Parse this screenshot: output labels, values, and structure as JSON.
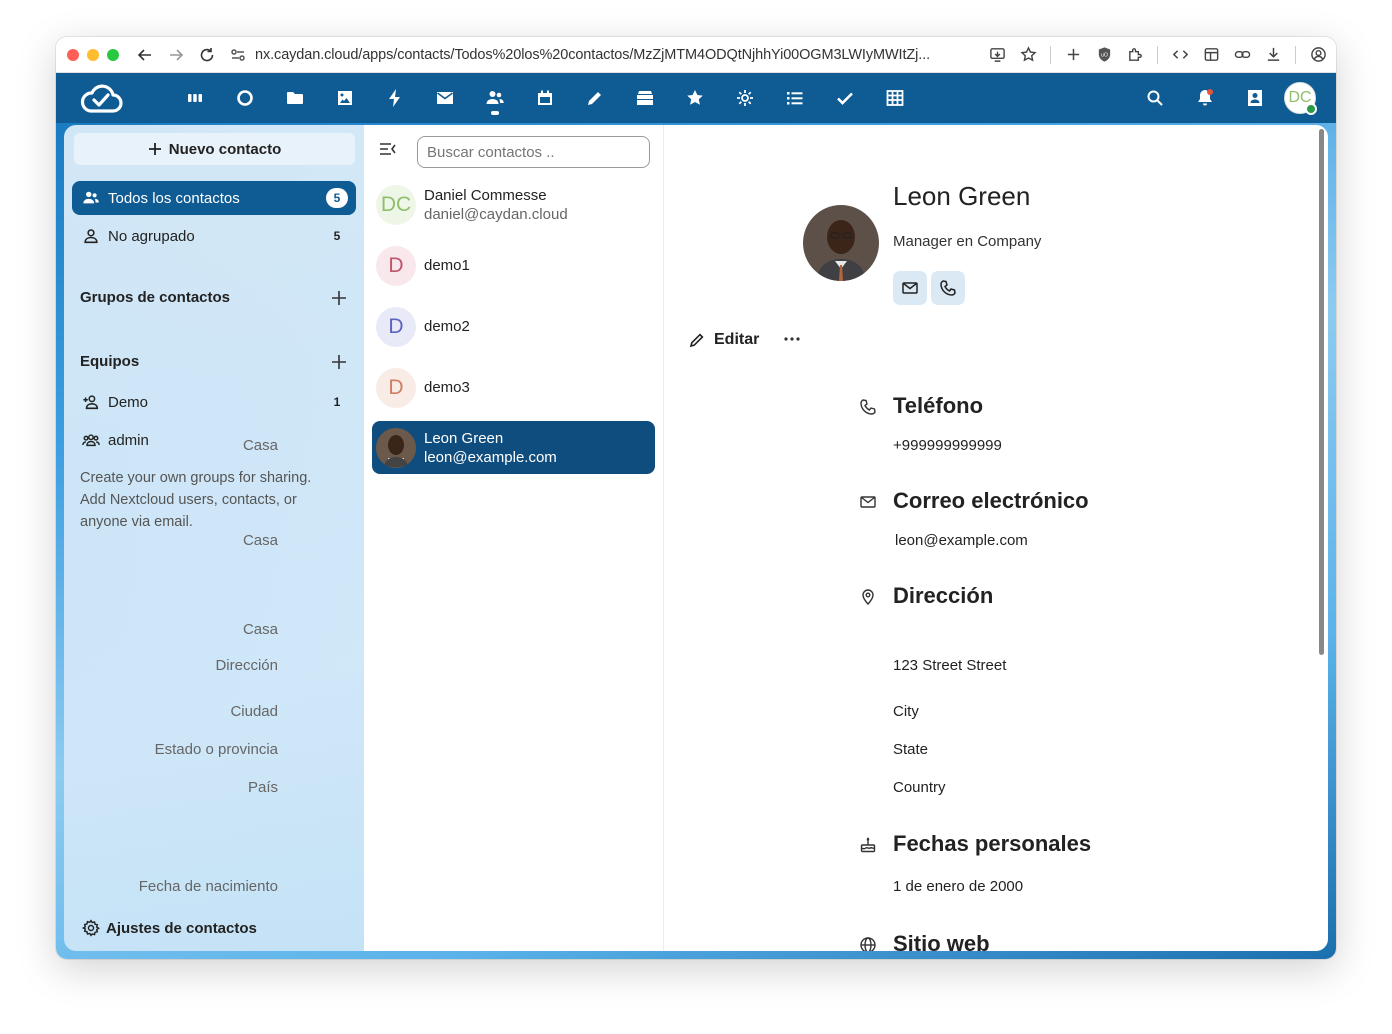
{
  "browser": {
    "url": "nx.caydan.cloud/apps/contacts/Todos%20los%20contactos/MzZjMTM4ODQtNjhhYi00OGM3LWIyMWItZj..."
  },
  "header": {
    "user_initials": "DC",
    "apps": [
      "dashboard",
      "search",
      "files",
      "photos",
      "activity",
      "mail",
      "contacts",
      "calendar",
      "notes",
      "deck",
      "favorites",
      "circles",
      "tasks-list",
      "tasks",
      "tables"
    ]
  },
  "sidebar": {
    "new_contact": "Nuevo contacto",
    "items": [
      {
        "label": "Todos los contactos",
        "count": "5"
      },
      {
        "label": "No agrupado",
        "count": "5"
      }
    ],
    "groups_title": "Grupos de contactos",
    "teams_title": "Equipos",
    "teams": [
      {
        "label": "Demo",
        "count": "1"
      },
      {
        "label": "admin",
        "count": ""
      }
    ],
    "help_text": "Create your own groups for sharing. Add Nextcloud users, contacts, or anyone via email.",
    "settings": "Ajustes de contactos"
  },
  "list": {
    "search_placeholder": "Buscar contactos ..",
    "contacts": [
      {
        "initials": "DC",
        "name": "Daniel Commesse",
        "email": "daniel@caydan.cloud",
        "color": "#8fbf6c",
        "bg": "#eef6e8"
      },
      {
        "initials": "D",
        "name": "demo1",
        "email": "",
        "color": "#c0546a",
        "bg": "#f8e8ec"
      },
      {
        "initials": "D",
        "name": "demo2",
        "email": "",
        "color": "#5b64c0",
        "bg": "#e8eaf7"
      },
      {
        "initials": "D",
        "name": "demo3",
        "email": "",
        "color": "#d17d66",
        "bg": "#f9ebe6"
      },
      {
        "initials": "",
        "name": "Leon Green",
        "email": "leon@example.com",
        "color": "#fff",
        "bg": "#333"
      }
    ]
  },
  "details": {
    "name": "Leon Green",
    "title": "Manager en Company",
    "edit": "Editar",
    "phone_title": "Teléfono",
    "phone_label": "Casa",
    "phone_value": "+999999999999",
    "email_title": "Correo electrónico",
    "email_label": "Casa",
    "email_value": "leon@example.com",
    "address_title": "Dirección",
    "address_type": "Casa",
    "address_fields": [
      {
        "label": "Dirección",
        "value": "123 Street Street"
      },
      {
        "label": "Ciudad",
        "value": "City"
      },
      {
        "label": "Estado o provincia",
        "value": "State"
      },
      {
        "label": "País",
        "value": "Country"
      }
    ],
    "dates_title": "Fechas personales",
    "birthday_label": "Fecha de nacimiento",
    "birthday_value": "1 de enero de 2000",
    "website_title": "Sitio web"
  },
  "colors": {
    "brand": "#0f5b93",
    "active_contact": "#0f4d7e"
  }
}
